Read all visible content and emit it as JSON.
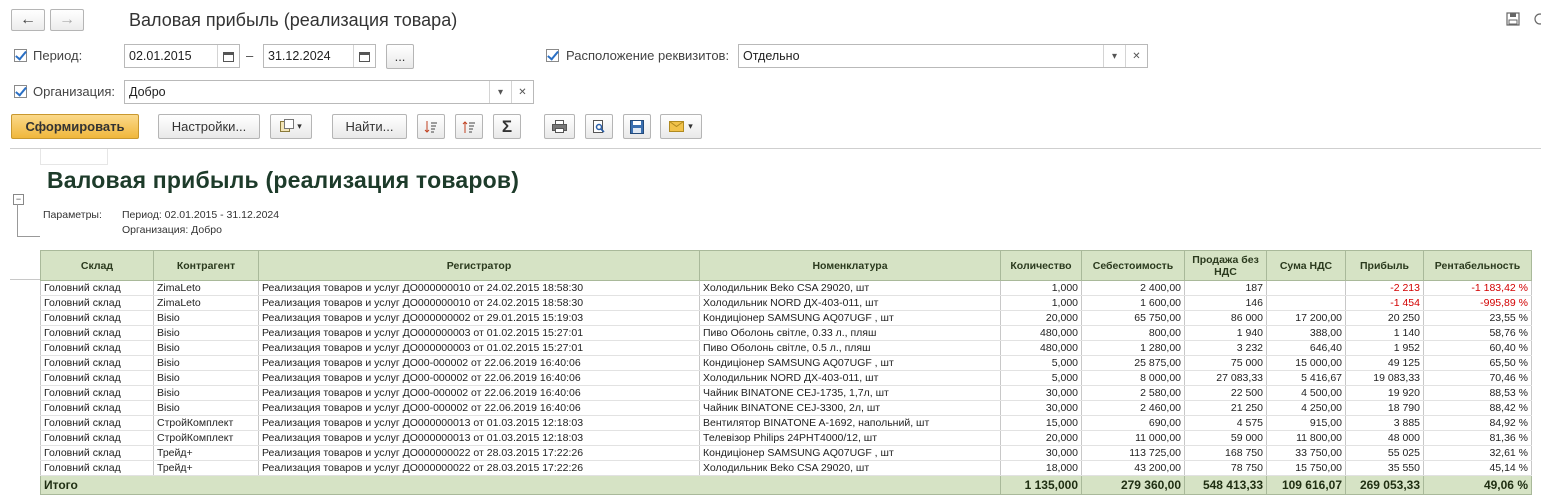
{
  "window": {
    "title": "Валовая прибыль (реализация товара)"
  },
  "filters": {
    "period_label": "Период:",
    "date_from": "02.01.2015",
    "date_sep": "–",
    "date_to": "31.12.2024",
    "more_btn": "...",
    "layout_label": "Расположение реквизитов:",
    "layout_value": "Отдельно",
    "org_label": "Организация:",
    "org_value": "Добро"
  },
  "toolbar": {
    "generate": "Сформировать",
    "settings": "Настройки...",
    "find": "Найти..."
  },
  "report": {
    "title": "Валовая прибыль (реализация товаров)",
    "params_label": "Параметры:",
    "params_period": "Период: 02.01.2015 - 31.12.2024",
    "params_org": "Организация: Добро",
    "headers": [
      "Склад",
      "Контрагент",
      "Регистратор",
      "Номенклатура",
      "Количество",
      "Себестоимость",
      "Продажа без НДС",
      "Сума НДС",
      "Прибыль",
      "Рентабельность"
    ],
    "rows": [
      [
        "Головний склад",
        "ZimaLeto",
        "Реализация товаров и услуг ДО000000010 от 24.02.2015 18:58:30",
        "Холодильник Beko CSA 29020, шт",
        "1,000",
        "2 400,00",
        "187",
        "",
        "-2 213",
        "-1 183,42 %"
      ],
      [
        "Головний склад",
        "ZimaLeto",
        "Реализация товаров и услуг ДО000000010 от 24.02.2015 18:58:30",
        "Холодильник NORD ДХ-403-011, шт",
        "1,000",
        "1 600,00",
        "146",
        "",
        "-1 454",
        "-995,89 %"
      ],
      [
        "Головний склад",
        "Bisio",
        "Реализация товаров и услуг ДО000000002 от 29.01.2015 15:19:03",
        "Кондиціонер SAMSUNG AQ07UGF , шт",
        "20,000",
        "65 750,00",
        "86 000",
        "17 200,00",
        "20 250",
        "23,55 %"
      ],
      [
        "Головний склад",
        "Bisio",
        "Реализация товаров и услуг ДО000000003 от 01.02.2015 15:27:01",
        "Пиво Оболонь світле, 0.33 л., пляш",
        "480,000",
        "800,00",
        "1 940",
        "388,00",
        "1 140",
        "58,76 %"
      ],
      [
        "Головний склад",
        "Bisio",
        "Реализация товаров и услуг ДО000000003 от 01.02.2015 15:27:01",
        "Пиво Оболонь світле, 0.5 л., пляш",
        "480,000",
        "1 280,00",
        "3 232",
        "646,40",
        "1 952",
        "60,40 %"
      ],
      [
        "Головний склад",
        "Bisio",
        "Реализация товаров и услуг ДО00-000002 от 22.06.2019 16:40:06",
        "Кондиціонер SAMSUNG AQ07UGF , шт",
        "5,000",
        "25 875,00",
        "75 000",
        "15 000,00",
        "49 125",
        "65,50 %"
      ],
      [
        "Головний склад",
        "Bisio",
        "Реализация товаров и услуг ДО00-000002 от 22.06.2019 16:40:06",
        "Холодильник NORD ДХ-403-011, шт",
        "5,000",
        "8 000,00",
        "27 083,33",
        "5 416,67",
        "19 083,33",
        "70,46 %"
      ],
      [
        "Головний склад",
        "Bisio",
        "Реализация товаров и услуг ДО00-000002 от 22.06.2019 16:40:06",
        "Чайник BINATONE CEJ-1735,  1,7л, шт",
        "30,000",
        "2 580,00",
        "22 500",
        "4 500,00",
        "19 920",
        "88,53 %"
      ],
      [
        "Головний склад",
        "Bisio",
        "Реализация товаров и услуг ДО00-000002 от 22.06.2019 16:40:06",
        "Чайник BINATONE CEJ-3300,  2л, шт",
        "30,000",
        "2 460,00",
        "21 250",
        "4 250,00",
        "18 790",
        "88,42 %"
      ],
      [
        "Головний склад",
        "СтройКомплект",
        "Реализация товаров и услуг ДО000000013 от 01.03.2015 12:18:03",
        "Вентилятор BINATONE A-1692, напольний, шт",
        "15,000",
        "690,00",
        "4 575",
        "915,00",
        "3 885",
        "84,92 %"
      ],
      [
        "Головний склад",
        "СтройКомплект",
        "Реализация товаров и услуг ДО000000013 от 01.03.2015 12:18:03",
        "Телевізор Philips 24PHT4000/12, шт",
        "20,000",
        "11 000,00",
        "59 000",
        "11 800,00",
        "48 000",
        "81,36 %"
      ],
      [
        "Головний склад",
        "Трейд+",
        "Реализация товаров и услуг ДО000000022 от 28.03.2015 17:22:26",
        "Кондиціонер SAMSUNG AQ07UGF , шт",
        "30,000",
        "113 725,00",
        "168 750",
        "33 750,00",
        "55 025",
        "32,61 %"
      ],
      [
        "Головний склад",
        "Трейд+",
        "Реализация товаров и услуг ДО000000022 от 28.03.2015 17:22:26",
        "Холодильник Beko CSA 29020, шт",
        "18,000",
        "43 200,00",
        "78 750",
        "15 750,00",
        "35 550",
        "45,14 %"
      ]
    ],
    "total": [
      "Итого",
      "1 135,000",
      "279 360,00",
      "548 413,33",
      "109 616,07",
      "269 053,33",
      "49,06 %"
    ]
  }
}
